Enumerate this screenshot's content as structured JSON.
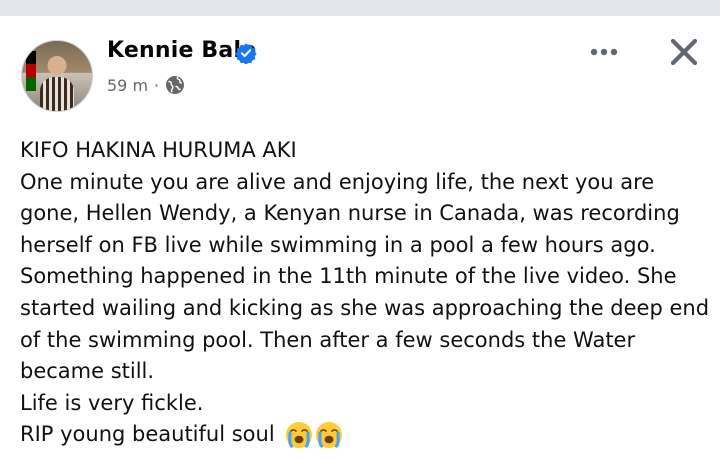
{
  "header": {
    "author_name": "Kennie Balo",
    "time_ago": "59 m",
    "separator": "·"
  },
  "icons": {
    "verified": "verified-badge-icon",
    "audience": "globe-icon",
    "more": "more-options-icon",
    "close": "close-icon",
    "emoji": "loudly-crying-face-emoji"
  },
  "colors": {
    "verified_blue": "#1877f2",
    "meta_gray": "#65676b"
  },
  "post": {
    "lines": [
      "KIFO HAKINA HURUMA AKI",
      "One minute you are alive and enjoying life, the next you are",
      "gone, Hellen Wendy, a Kenyan nurse in Canada, was recording",
      "herself on FB live while swimming in a pool a few hours ago.",
      "Something happened in the 11th minute of the live video. She",
      "started wailing and kicking as she was approaching the deep end",
      "of the swimming pool. Then after a few seconds the Water",
      "became still.",
      "Life is very fickle.",
      "RIP young beautiful soul"
    ]
  }
}
